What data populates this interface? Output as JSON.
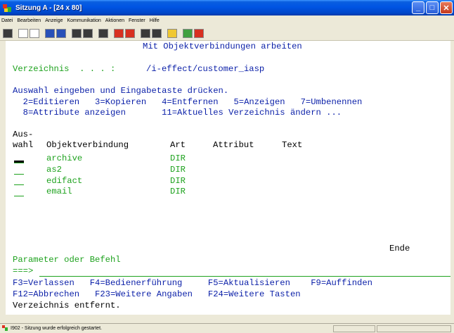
{
  "window": {
    "title": "Sitzung A - [24 x 80]",
    "min_label": "_",
    "max_label": "□",
    "close_label": "✕"
  },
  "menu": [
    "Datei",
    "Bearbeiten",
    "Anzeige",
    "Kommunikation",
    "Aktionen",
    "Fenster",
    "Hilfe"
  ],
  "toolbar": {
    "icons": [
      "print-screen-icon",
      "copy-icon",
      "paste-icon",
      "send-icon",
      "receive-icon",
      "display-icon",
      "keyboard-icon",
      "record-macro-icon",
      "play-macro-icon",
      "macro-icon",
      "customize-icon",
      "clipboard-icon",
      "help-icon",
      "settings-icon"
    ]
  },
  "screen": {
    "title": "Mit Objektverbindungen arbeiten",
    "dir_label": "Verzeichnis  . . . :",
    "dir_value": "/i-effect/customer_iasp",
    "instruction": "Auswahl eingeben und Eingabetaste drücken.",
    "opts_line1": "  2=Editieren   3=Kopieren   4=Entfernen   5=Anzeigen   7=Umbenennen",
    "opts_line2": "  8=Attribute anzeigen       11=Aktuelles Verzeichnis ändern ...",
    "col_aus": "Aus-",
    "col_wahl": "wahl",
    "col_obj": "Objektverbindung",
    "col_art": "Art",
    "col_attr": "Attribut",
    "col_text": "Text",
    "rows": [
      {
        "name": "archive",
        "type": "DIR"
      },
      {
        "name": "as2",
        "type": "DIR"
      },
      {
        "name": "edifact",
        "type": "DIR"
      },
      {
        "name": "email",
        "type": "DIR"
      }
    ],
    "ende": "Ende",
    "param_label": "Parameter oder Befehl",
    "prompt": "===>",
    "fkeys1": "F3=Verlassen   F4=Bedienerführung     F5=Aktualisieren    F9=Auffinden",
    "fkeys2": "F12=Abbrechen   F23=Weitere Angaben   F24=Weitere Tasten",
    "message": "Verzeichnis entfernt."
  },
  "status": {
    "text": "I902 - Sitzung wurde erfolgreich gestartet."
  }
}
